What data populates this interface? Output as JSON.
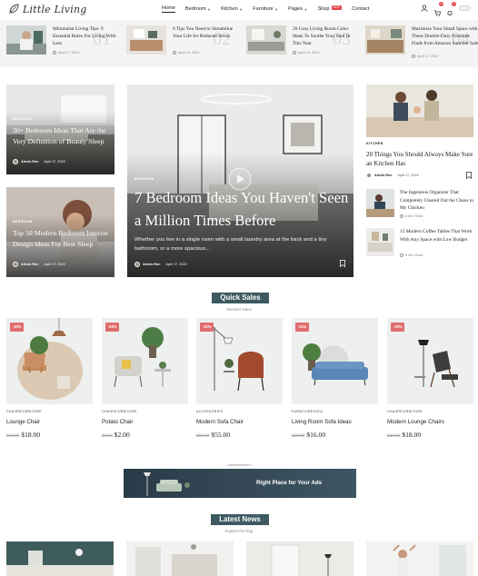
{
  "brand": {
    "name": "Little Living"
  },
  "nav": {
    "items": [
      {
        "label": "Home",
        "active": true,
        "has_dropdown": false
      },
      {
        "label": "Bedroom",
        "active": false,
        "has_dropdown": true
      },
      {
        "label": "Kitchen",
        "active": false,
        "has_dropdown": true
      },
      {
        "label": "Furniture",
        "active": false,
        "has_dropdown": true
      },
      {
        "label": "Pages",
        "active": false,
        "has_dropdown": true
      },
      {
        "label": "Shop",
        "active": false,
        "has_dropdown": false,
        "badge": "HOT"
      },
      {
        "label": "Contact",
        "active": false,
        "has_dropdown": false
      }
    ],
    "icons": [
      "user-icon",
      "cart-icon",
      "bell-icon",
      "theme-toggle-icon"
    ]
  },
  "top_strip": [
    {
      "title": "Minimalist Living Tips: 9 Essential Rules For Living With Less",
      "date": "April 17, 2022",
      "number": "01"
    },
    {
      "title": "6 Tips You Need to Streamline Your Life for Reduced Stress",
      "date": "April 16, 2022",
      "number": "02"
    },
    {
      "title": "20 Gray Living Room Color Ideas To Soothe Your Soul In This Year",
      "date": "April 15, 2022",
      "number": "03"
    },
    {
      "title": "Maximize Your Small Space with These Double-Duty Furniture Finds from Amazon Summer Sale",
      "date": "April 17, 2022",
      "number": "04"
    }
  ],
  "left_cards": [
    {
      "category": "Bedroom",
      "title": "30+ Bedroom Ideas That Are the Very Definition of Beauty Sleep",
      "author": "Alexis Ren",
      "date": "April 17, 2022"
    },
    {
      "category": "Bedroom",
      "title": "Top 50 Modern Bedroom Interior Design Ideas For Best Sleep",
      "author": "Alexis Ren",
      "date": "April 17, 2022"
    }
  ],
  "feature": {
    "category": "Bedroom",
    "title": "7 Bedroom Ideas You Haven't Seen a Million Times Before",
    "excerpt": "Whether you live in a single room with a small laundry area at the back and a tiny bathroom, or a more spacious...",
    "author": "Alexis Ren",
    "date": "April 17, 2022"
  },
  "right_column": {
    "main": {
      "category": "Kitchen",
      "title": "20 Things You Should Always Make Sure an Kitchen Has",
      "author": "Alexis Ren",
      "date": "April 17, 2022"
    },
    "items": [
      {
        "title": "The Ingenious Organizer That Completely Cleared Out the Chaos in My Chicken",
        "read": "6 Min Read"
      },
      {
        "title": "15 Modern Coffee Tables That Work With Any Space with Low Budget",
        "read": "6 Min Read"
      }
    ]
  },
  "quick_sales": {
    "label": "Quick Sales",
    "subtitle": "Summer Sales",
    "products": [
      {
        "discount": "-10%",
        "category": "Chairsfurniture",
        "name": "Lounge Chair",
        "old_price": "$20.00",
        "price": "$18.00"
      },
      {
        "discount": "-33%",
        "category": "Chairsfurniture",
        "name": "Potato Chair",
        "old_price": "$3.00",
        "price": "$2.00"
      },
      {
        "discount": "-12%",
        "category": "Accessories",
        "name": "Modern Sofa Chair",
        "old_price": "$65.00",
        "price": "$55.00"
      },
      {
        "discount": "-11%",
        "category": "Furnituresofa",
        "name": "Living Room Sofa Ideas",
        "old_price": "$29.00",
        "price": "$16.00"
      },
      {
        "discount": "-10%",
        "category": "Chairsfurniture",
        "name": "Modern Lounge Chairs",
        "old_price": "$20.00",
        "price": "$18.00"
      }
    ]
  },
  "ad": {
    "label": "- Advertisement -",
    "text": "Right Place for Your Ads"
  },
  "latest_news": {
    "label": "Latest News",
    "subtitle": "Explore the blog"
  },
  "colors": {
    "accent": "#3e5a61",
    "sale": "#e06c6c",
    "hot": "#e8454f",
    "strip_bg": "#f4f4f4"
  }
}
